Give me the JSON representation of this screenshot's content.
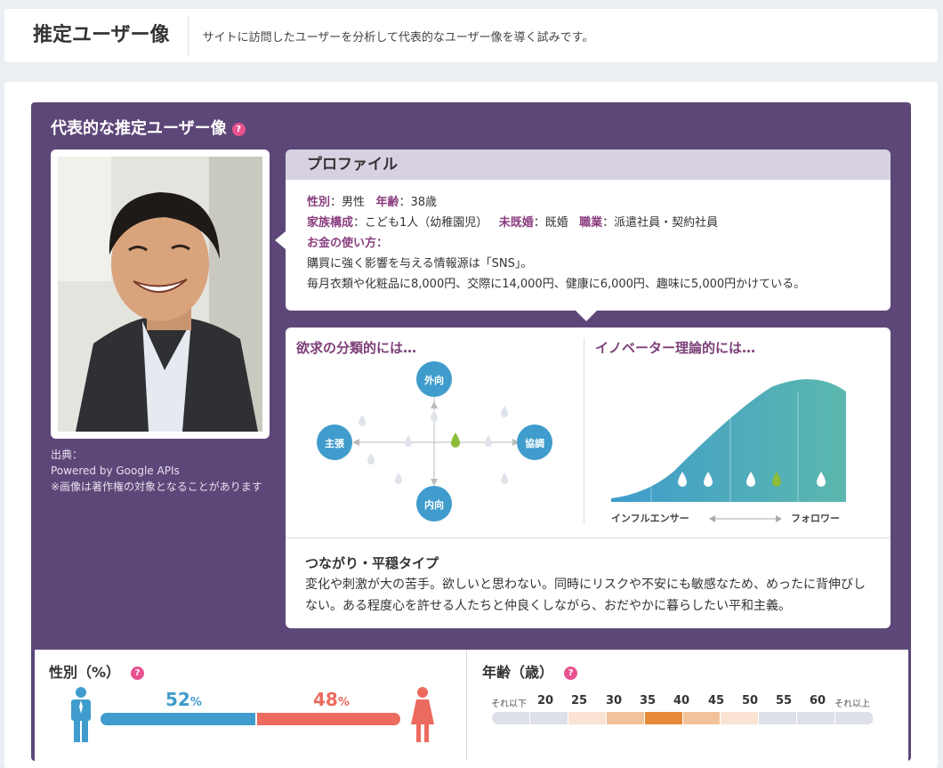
{
  "header": {
    "title": "推定ユーザー像",
    "description": "サイトに訪問したユーザーを分析して代表的なユーザー像を導く試みです。"
  },
  "section": {
    "title": "代表的な推定ユーザー像",
    "help": "?"
  },
  "photo": {
    "credit_1": "出典：",
    "credit_2": "Powered by Google APIs",
    "credit_3": "※画像は著作権の対象となることがあります"
  },
  "profile": {
    "heading": "プロファイル",
    "gender_label": "性別",
    "gender_value": "：男性",
    "age_label": "年齢",
    "age_value": "：38歳",
    "family_label": "家族構成",
    "family_value": "：こども1人（幼稚園児）",
    "married_label": "未既婚",
    "married_value": "：既婚",
    "job_label": "職業",
    "job_value": "：派遣社員・契約社員",
    "money_label": "お金の使い方：",
    "money_line1": "購買に強く影響を与える情報源は「SNS」。",
    "money_line2": "毎月衣類や化粧品に8,000円、交際に14,000円、健康に6,000円、趣味に5,000円かけている。"
  },
  "needs": {
    "title": "欲求の分類的には…",
    "top": "外向",
    "bottom": "内向",
    "left": "主張",
    "right": "協調"
  },
  "innovator": {
    "title": "イノベーター理論的には…",
    "left_label": "インフルエンサー",
    "right_label": "フォロワー"
  },
  "type": {
    "title": "つながり・平穏タイプ",
    "description": "変化や刺激が大の苦手。欲しいと思わない。同時にリスクや不安にも敏感なため、めったに背伸びしない。ある程度心を許せる人たちと仲良くしながら、おだやかに暮らしたい平和主義。"
  },
  "gender_stats": {
    "title": "性別（%）",
    "male_pct": "52",
    "female_pct": "48",
    "pct_unit": "%",
    "male_fraction": 0.52,
    "female_fraction": 0.48
  },
  "age_stats": {
    "title": "年齢（歳）",
    "below": "それ以下",
    "above": "それ以上",
    "ticks": [
      "20",
      "25",
      "30",
      "35",
      "40",
      "45",
      "50",
      "55",
      "60"
    ],
    "segment_colors": [
      "#dde0e6",
      "#dde0e6",
      "#fbe3d3",
      "#f2c29a",
      "#e8893a",
      "#f2c29a",
      "#fbe3d3",
      "#dde0e6",
      "#dde0e6",
      "#dde0e6"
    ]
  },
  "colors": {
    "accent_purple": "#5d4778",
    "male_blue": "#3f9ccc",
    "female_red": "#ec6a5e",
    "help_pink": "#e8528f"
  }
}
